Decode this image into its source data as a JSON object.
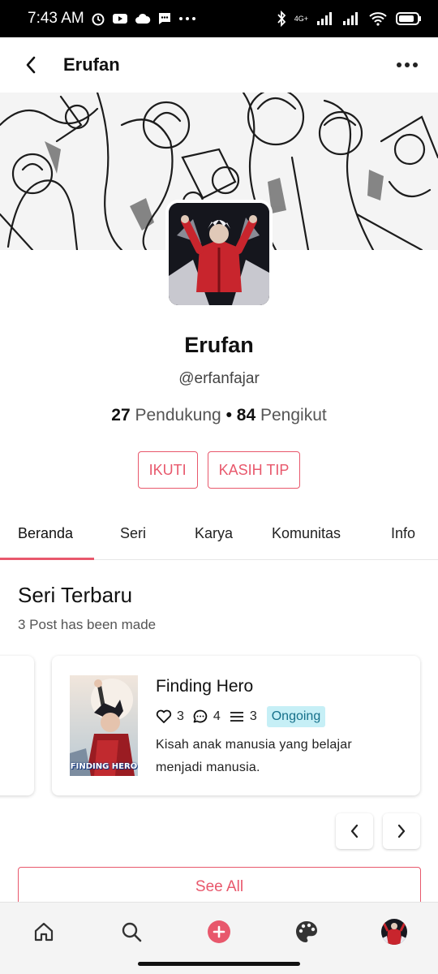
{
  "status_bar": {
    "time": "7:43 AM",
    "network": "4G+",
    "left_icons": [
      "alarm-icon",
      "youtube-icon",
      "cloud-icon",
      "message-icon",
      "more-dots-icon"
    ],
    "right_icons": [
      "bluetooth-icon",
      "signal-icon",
      "signal-icon",
      "wifi-icon",
      "battery-icon"
    ]
  },
  "app_bar": {
    "title": "Erufan",
    "back_icon": "back-arrow-icon",
    "menu_icon": "more-horizontal-icon"
  },
  "profile": {
    "name": "Erufan",
    "handle": "@erfanfajar",
    "supporters_count": "27",
    "supporters_label": "Pendukung",
    "separator": "•",
    "followers_count": "84",
    "followers_label": "Pengikut",
    "follow_button": "IKUTI",
    "tip_button": "KASIH TIP"
  },
  "tabs": [
    {
      "label": "Beranda",
      "active": true
    },
    {
      "label": "Seri",
      "active": false
    },
    {
      "label": "Karya",
      "active": false
    },
    {
      "label": "Komunitas",
      "active": false
    },
    {
      "label": "Info",
      "active": false
    }
  ],
  "section": {
    "title": "Seri Terbaru",
    "subtitle": "3 Post has been made"
  },
  "series_card": {
    "title": "Finding Hero",
    "likes": "3",
    "comments": "4",
    "chapters": "3",
    "status": "Ongoing",
    "description": "Kisah anak manusia yang belajar menjadi manusia.",
    "cover_text": "FINDING HERO"
  },
  "see_all": "See All",
  "bottom_nav": [
    {
      "icon": "home-icon"
    },
    {
      "icon": "search-icon"
    },
    {
      "icon": "plus-circle-icon"
    },
    {
      "icon": "palette-icon"
    },
    {
      "icon": "profile-avatar-icon"
    }
  ],
  "colors": {
    "accent": "#e8586c",
    "badge_bg": "#c6eff6",
    "badge_text": "#16708a"
  }
}
